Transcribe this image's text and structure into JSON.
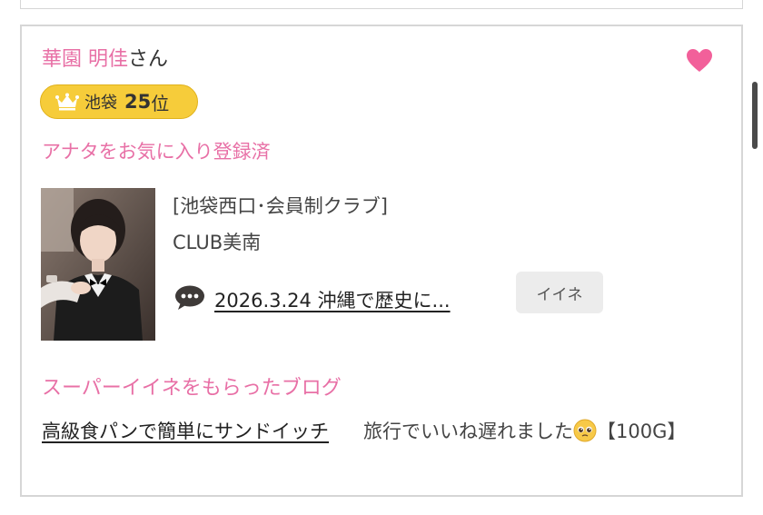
{
  "cast": {
    "name": "華園 明佳",
    "name_suffix": "さん",
    "rank_area": "池袋",
    "rank_number": "25",
    "rank_unit": "位",
    "favorite_status": "アナタをお気に入り登録済",
    "shop_category": "[池袋西口･会員制クラブ]",
    "shop_name": "CLUB美南",
    "latest_blog": "2026.3.24 沖縄で歴史に...",
    "iine_label": "イイネ"
  },
  "super_iine": {
    "title": "スーパーイイネをもらったブログ",
    "blogs": [
      {
        "title": "高級食パンで簡単にサンドイッチ"
      },
      {
        "title_before_emoji": "旅行でいいね遅れました",
        "title_after_emoji": "【100G】"
      }
    ]
  },
  "colors": {
    "accent_pink": "#e870a6",
    "badge_gold": "#f6cc3a",
    "heart": "#f2609a"
  },
  "icons": [
    "heart-icon",
    "crown-icon",
    "comment-bubble-icon",
    "pleading-face-emoji"
  ]
}
